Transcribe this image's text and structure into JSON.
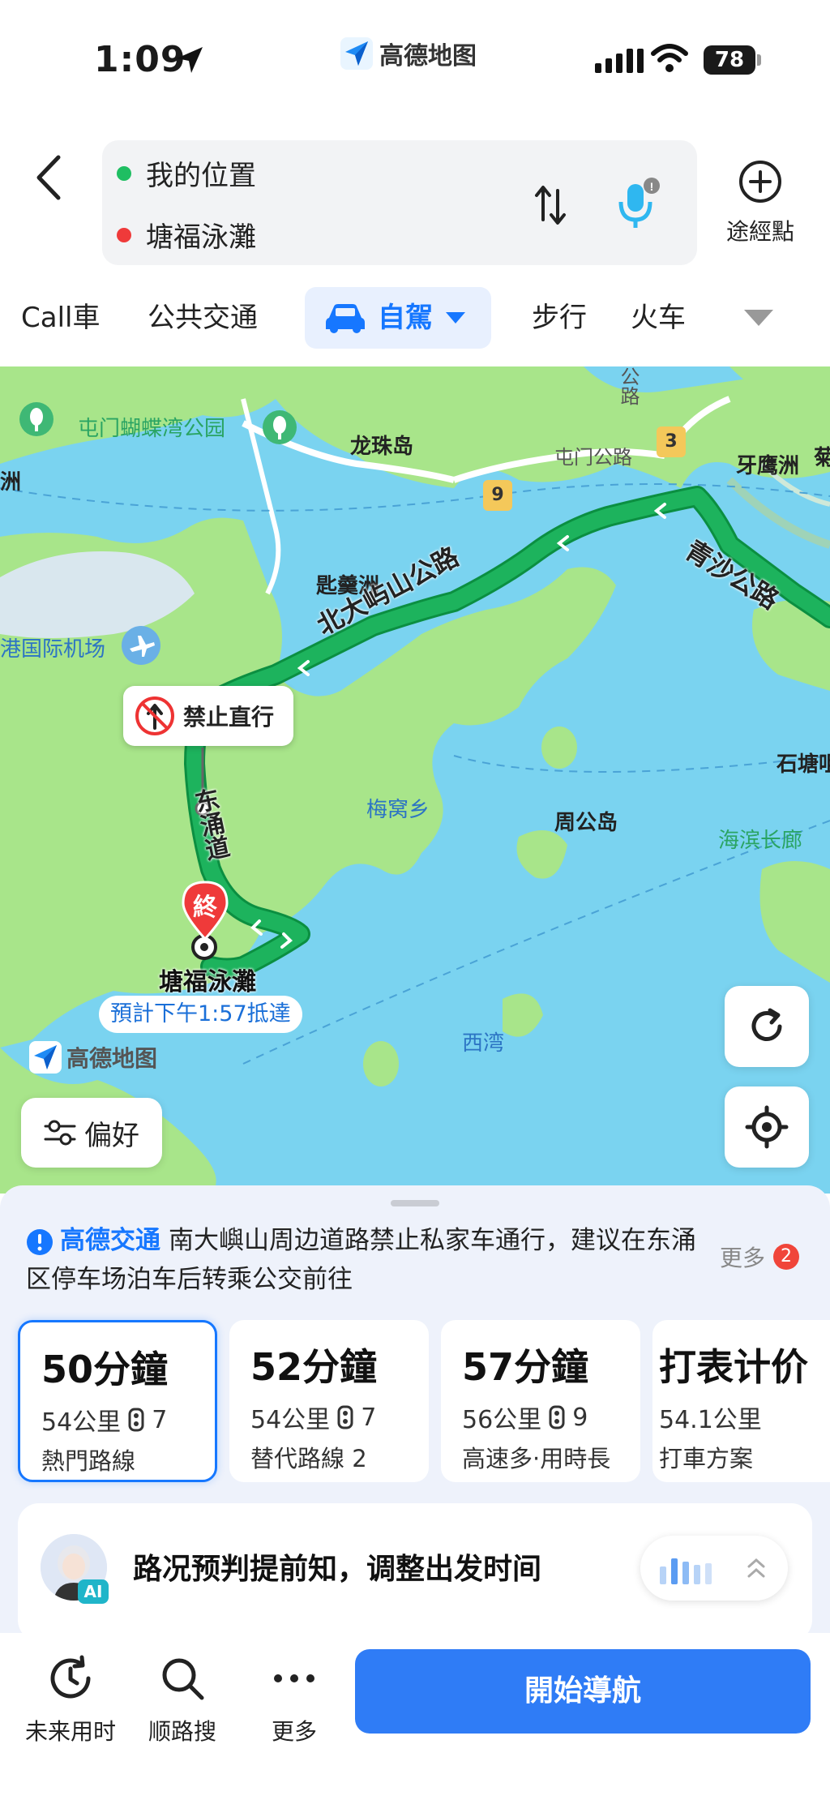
{
  "status_bar": {
    "time": "1:09",
    "app_name": "高德地图",
    "battery": "78"
  },
  "route": {
    "from": "我的位置",
    "to": "塘福泳灘",
    "waypoint_label": "途經點"
  },
  "tabs": {
    "items": [
      {
        "label": "Call車"
      },
      {
        "label": "公共交通"
      },
      {
        "label": "自駕",
        "active": true
      },
      {
        "label": "步行"
      },
      {
        "label": "火车"
      }
    ]
  },
  "map": {
    "places": {
      "park": "屯门蝴蝶湾公园",
      "longzhu": "龙珠岛",
      "yayingzhou": "牙鹰洲",
      "chek_lap_kok_edge": "洲",
      "airport": "港国际机场",
      "siuchau": "匙羹洲",
      "meiwo": "梅窝乡",
      "peng_chau": "周公岛",
      "shek_tong": "石塘咀",
      "seaside": "海滨长廊",
      "sai_wan": "西湾",
      "edge_right": "菊"
    },
    "roads": {
      "tuen_mun_rd": "屯门公路",
      "route_9": "9",
      "route_3": "3",
      "north_lantau": "北大屿山公路",
      "tsing_sha": "青沙公路",
      "tung_chung": "东涌道",
      "top_road": "公路"
    },
    "alert_label": "禁止直行",
    "destination_pin": "終",
    "destination_name": "塘福泳灘",
    "eta": "預計下午1:57抵達",
    "watermark": "高德地图",
    "preferences_label": "偏好"
  },
  "notice": {
    "source": "高德交通",
    "text": "南大嶼山周边道路禁止私家车通行，建议在东涌区停车场泊车后转乘公交前往",
    "more_label": "更多",
    "more_count": "2"
  },
  "routes": [
    {
      "duration": "50分鐘",
      "distance": "54公里",
      "lights": "7",
      "tag": "熱門路線",
      "selected": true
    },
    {
      "duration": "52分鐘",
      "distance": "54公里",
      "lights": "7",
      "tag": "替代路線 2"
    },
    {
      "duration": "57分鐘",
      "distance": "56公里",
      "lights": "9",
      "tag": "高速多·用時長"
    },
    {
      "duration": "打表计价",
      "distance": "54.1公里",
      "lights": "",
      "tag": "打車方案"
    }
  ],
  "ai_card": {
    "badge": "AI",
    "text": "路况预判提前知，调整出发时间"
  },
  "bottom_bar": {
    "future_label": "未来用时",
    "search_label": "顺路搜",
    "more_label": "更多",
    "start_label": "開始導航"
  },
  "colors": {
    "accent": "#1677ff",
    "route_green": "#1db35d",
    "start_button": "#2f7cf6",
    "map_water": "#7ad3f0",
    "map_land": "#a8e58a"
  }
}
